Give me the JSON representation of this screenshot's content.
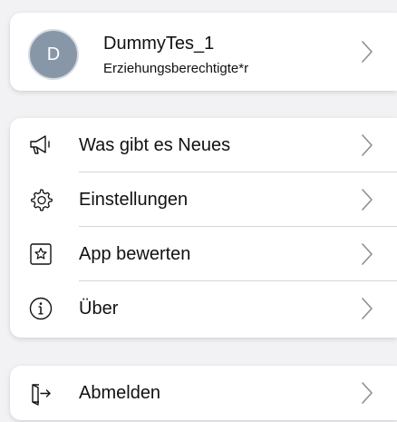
{
  "profile": {
    "avatar_initial": "D",
    "name": "DummyTes_1",
    "role": "Erziehungsberechtigte*r"
  },
  "menu": {
    "items": [
      {
        "label": "Was gibt es Neues",
        "icon": "megaphone-icon"
      },
      {
        "label": "Einstellungen",
        "icon": "gear-icon"
      },
      {
        "label": "App bewerten",
        "icon": "star-box-icon"
      },
      {
        "label": "Über",
        "icon": "info-icon"
      }
    ]
  },
  "logout": {
    "label": "Abmelden",
    "icon": "logout-door-icon"
  },
  "colors": {
    "background": "#f2f2f4",
    "card": "#ffffff",
    "avatar": "#8797a8",
    "chevron": "#8e8e93",
    "text": "#111111"
  }
}
